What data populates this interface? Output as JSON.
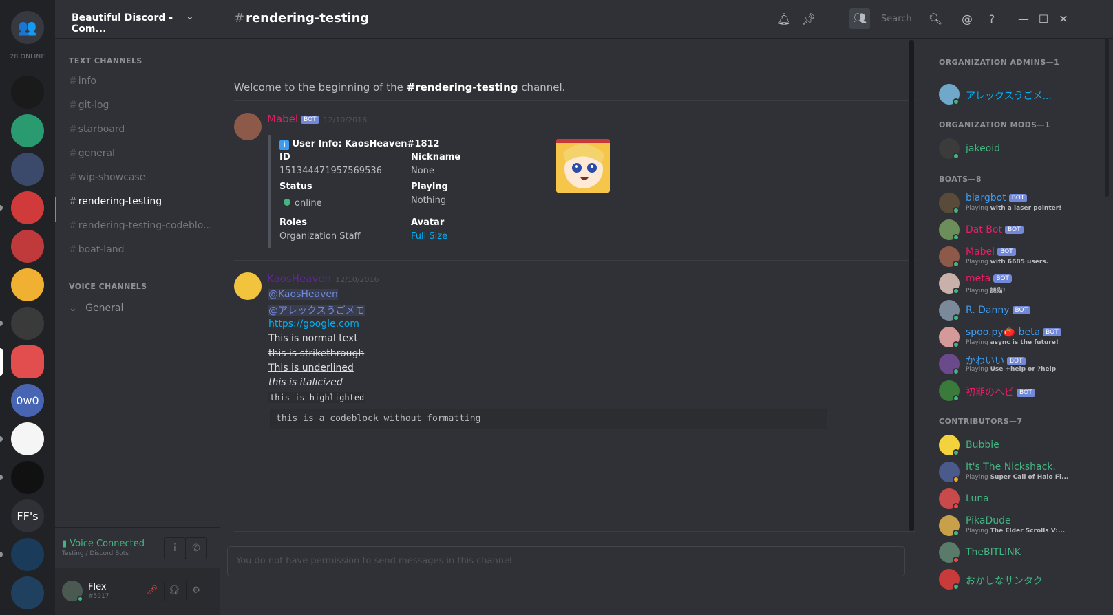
{
  "guilds": {
    "online_count": "28 ONLINE",
    "items": [
      {
        "label": "",
        "color": "#1a1a1a"
      },
      {
        "label": "",
        "color": "#2a9a70"
      },
      {
        "label": "",
        "color": "#3b4a6b"
      },
      {
        "label": "",
        "color": "#d03a3a"
      },
      {
        "label": "",
        "color": "#c0393b"
      },
      {
        "label": "",
        "color": "#f0b132"
      },
      {
        "label": "",
        "color": "#3a3a3a"
      },
      {
        "label": "",
        "color": "#e24d4d"
      },
      {
        "label": "0w0",
        "color": "#4765b3"
      },
      {
        "label": "",
        "color": "#f5f5f5"
      },
      {
        "label": "",
        "color": "#111111"
      },
      {
        "label": "FF's",
        "color": "#2f3136"
      },
      {
        "label": "",
        "color": "#1b3b5a"
      },
      {
        "label": "",
        "color": "#204060"
      }
    ]
  },
  "server": {
    "name": "Beautiful Discord - Com..."
  },
  "channels": {
    "text_header": "TEXT CHANNELS",
    "voice_header": "VOICE CHANNELS",
    "text": [
      "info",
      "git-log",
      "starboard",
      "general",
      "wip-showcase",
      "rendering-testing",
      "rendering-testing-codeblo...",
      "boat-land"
    ],
    "voice": [
      "General"
    ],
    "selected": "rendering-testing"
  },
  "voice_panel": {
    "status": "Voice Connected",
    "sub": "Testing / Discord Bots"
  },
  "user_panel": {
    "name": "Flex",
    "discriminator": "#5917"
  },
  "topbar": {
    "channel": "rendering-testing",
    "search_placeholder": "Search"
  },
  "chat": {
    "welcome_prefix": "Welcome to the beginning of the ",
    "welcome_channel": "#rendering-testing",
    "welcome_suffix": " channel.",
    "msg1": {
      "author": "Mabel",
      "bot_label": "BOT",
      "timestamp": "12/10/2016",
      "embed": {
        "title": "User Info: KaosHeaven#1812",
        "id_label": "ID",
        "id_value": "151344471957569536",
        "nickname_label": "Nickname",
        "nickname_value": "None",
        "status_label": "Status",
        "status_value": "online",
        "playing_label": "Playing",
        "playing_value": "Nothing",
        "roles_label": "Roles",
        "roles_value": "Organization Staff",
        "avatar_label": "Avatar",
        "avatar_value": "Full Size"
      }
    },
    "msg2": {
      "author": "KaosHeaven",
      "timestamp": "12/10/2016",
      "lines": {
        "mention1": "@KaosHeaven",
        "mention2": "@アレックスうごメモ",
        "link": "https://google.com",
        "normal": "This is normal text",
        "strike": "this is strikethrough",
        "underline": "This is underlined",
        "italic": "this is italicized",
        "highlight": "this is highlighted"
      },
      "codeblock": "this is a codeblock without formatting"
    },
    "composer_placeholder": "You do not have permission to send messages in this channel."
  },
  "members": {
    "groups": [
      {
        "title": "ORGANIZATION ADMINS—1",
        "members": [
          {
            "name": "アレックスうごメ...",
            "color": "#00b0f4",
            "bot": false,
            "sub_prefix": "",
            "sub_game": "",
            "status": "#43b581"
          }
        ]
      },
      {
        "title": "ORGANIZATION MODS—1",
        "members": [
          {
            "name": "jakeoid",
            "color": "#43b581",
            "bot": false,
            "sub_prefix": "",
            "sub_game": "",
            "status": "#43b581"
          }
        ]
      },
      {
        "title": "BOATS—8",
        "members": [
          {
            "name": "blargbot",
            "color": "#3d9cf0",
            "bot": true,
            "sub_prefix": "Playing ",
            "sub_game": "with a laser pointer!",
            "status": "#43b581"
          },
          {
            "name": "Dat Bot",
            "color": "#e91e63",
            "bot": true,
            "sub_prefix": "",
            "sub_game": "",
            "status": "#43b581"
          },
          {
            "name": "Mabel",
            "color": "#e91e63",
            "bot": true,
            "sub_prefix": "Playing ",
            "sub_game": "with 6685 users.",
            "status": "#43b581"
          },
          {
            "name": "meta",
            "color": "#e91e63",
            "bot": true,
            "sub_prefix": "Playing ",
            "sub_game": "謎猫!",
            "status": "#43b581"
          },
          {
            "name": "R. Danny",
            "color": "#3d9cf0",
            "bot": true,
            "sub_prefix": "",
            "sub_game": "",
            "status": "#43b581"
          },
          {
            "name": "spoo.py🍅 beta",
            "color": "#3d9cf0",
            "bot": true,
            "sub_prefix": "Playing ",
            "sub_game": "async is the future!",
            "status": "#43b581"
          },
          {
            "name": "かわいい",
            "color": "#3d9cf0",
            "bot": true,
            "sub_prefix": "Playing ",
            "sub_game": "Use +help or ?help",
            "status": "#43b581"
          },
          {
            "name": "初期のヘビ",
            "color": "#e91e63",
            "bot": true,
            "sub_prefix": "",
            "sub_game": "",
            "status": "#43b581"
          }
        ]
      },
      {
        "title": "CONTRIBUTORS—7",
        "members": [
          {
            "name": "Bubbie",
            "color": "#43b581",
            "bot": false,
            "sub_prefix": "",
            "sub_game": "",
            "status": "#43b581"
          },
          {
            "name": "It's The Nickshack.",
            "color": "#43b581",
            "bot": false,
            "sub_prefix": "Playing ",
            "sub_game": "Super Call of Halo Fi...",
            "status": "#faa61a"
          },
          {
            "name": "Luna",
            "color": "#43b581",
            "bot": false,
            "sub_prefix": "",
            "sub_game": "",
            "status": "#f04747"
          },
          {
            "name": "PikaDude",
            "color": "#43b581",
            "bot": false,
            "sub_prefix": "Playing ",
            "sub_game": "The Elder Scrolls V:...",
            "status": "#43b581"
          },
          {
            "name": "TheBITLINK",
            "color": "#43b581",
            "bot": false,
            "sub_prefix": "",
            "sub_game": "",
            "status": "#f04747"
          },
          {
            "name": "おかしなサンタク",
            "color": "#43b581",
            "bot": false,
            "sub_prefix": "",
            "sub_game": "",
            "status": "#43b581"
          }
        ]
      }
    ]
  },
  "colors": {
    "accent": "#7289da",
    "online": "#43b581",
    "mabel": "#e91e63",
    "kaos": "#5d2a8c",
    "link": "#00b0f4"
  }
}
